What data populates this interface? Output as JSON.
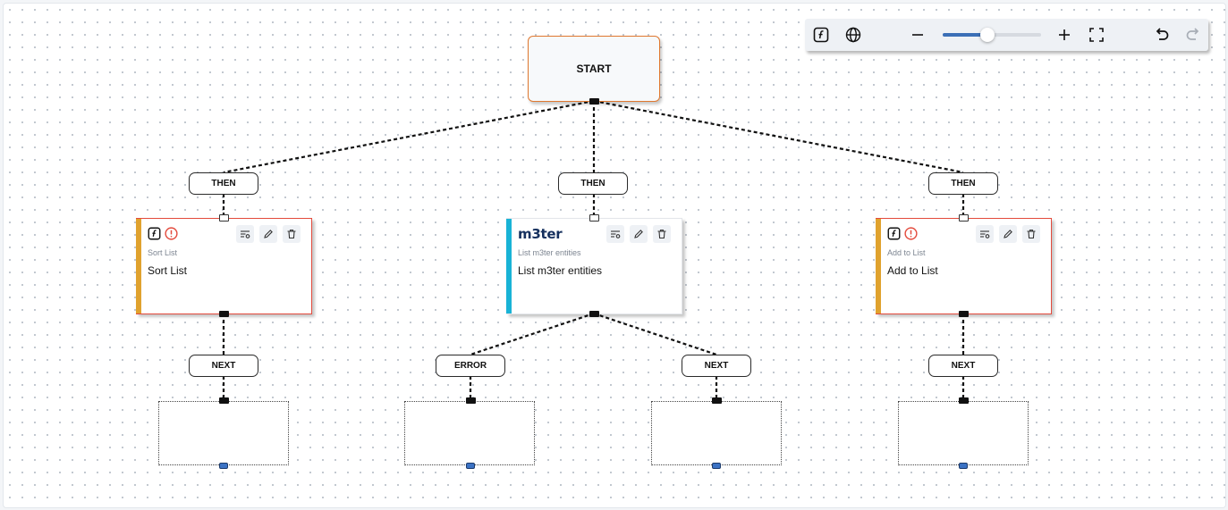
{
  "toolbar": {
    "function_icon": "function-icon",
    "globe_icon": "globe-icon",
    "zoom_out_icon": "minus-icon",
    "zoom_in_icon": "plus-icon",
    "fit_icon": "fullscreen-icon",
    "undo_icon": "undo-icon",
    "redo_icon": "redo-icon",
    "zoom_level": 0.45
  },
  "start": {
    "label": "START"
  },
  "connectors": {
    "then": "THEN",
    "next": "NEXT",
    "error": "ERROR"
  },
  "cards": {
    "sort_list": {
      "subtitle": "Sort List",
      "title": "Sort List"
    },
    "m3ter": {
      "logo": "m3ter",
      "subtitle": "List m3ter entities",
      "title": "List m3ter entities"
    },
    "add_to_list": {
      "subtitle": "Add to List",
      "title": "Add to List"
    }
  },
  "colors": {
    "accent": "#3b6fb6",
    "start_border": "#e0782f",
    "warning_border": "#e34a3c",
    "warning_bar": "#e0a22e",
    "m3ter_bar": "#19b3d6"
  }
}
